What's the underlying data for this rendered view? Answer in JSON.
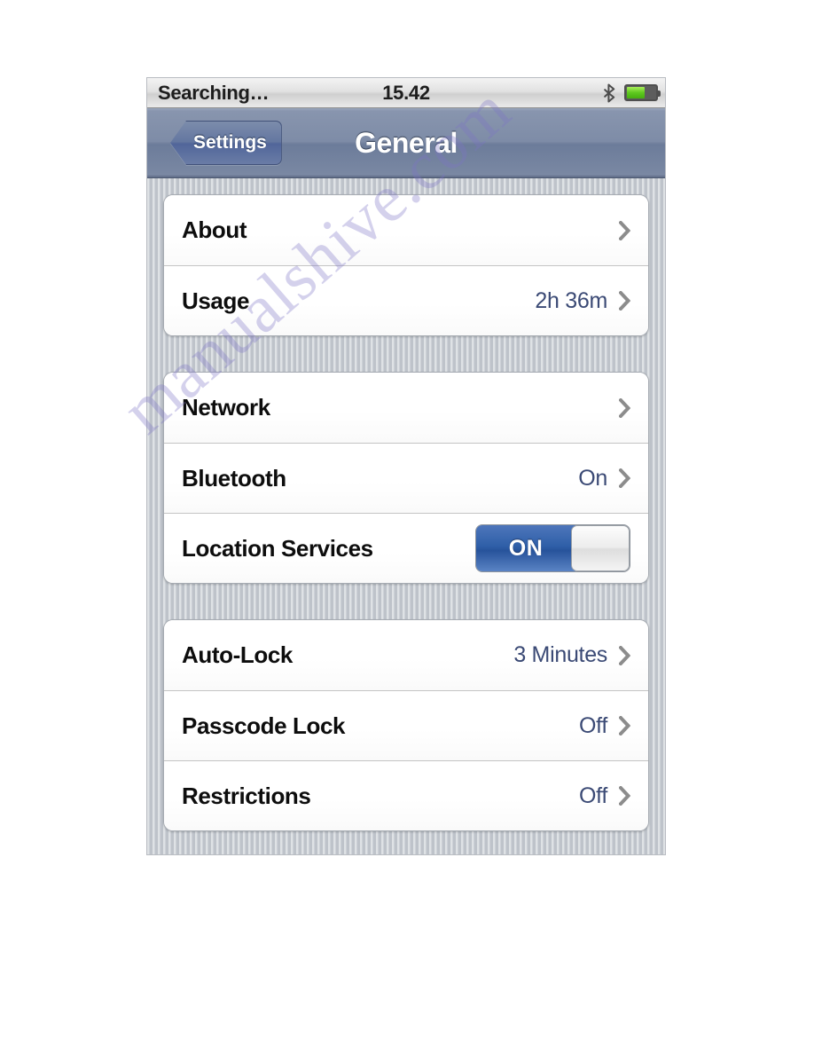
{
  "statusbar": {
    "carrier": "Searching…",
    "time": "15.42",
    "bluetooth_icon": "bluetooth-icon",
    "battery_icon": "battery-icon",
    "battery_level_percent": 58
  },
  "navbar": {
    "back_label": "Settings",
    "title": "General"
  },
  "groups": [
    {
      "rows": [
        {
          "label": "About",
          "value": "",
          "accessory": "chevron"
        },
        {
          "label": "Usage",
          "value": "2h 36m",
          "accessory": "chevron"
        }
      ]
    },
    {
      "rows": [
        {
          "label": "Network",
          "value": "",
          "accessory": "chevron"
        },
        {
          "label": "Bluetooth",
          "value": "On",
          "accessory": "chevron"
        },
        {
          "label": "Location Services",
          "value": "",
          "accessory": "switch",
          "switch_state": "ON"
        }
      ]
    },
    {
      "rows": [
        {
          "label": "Auto-Lock",
          "value": "3 Minutes",
          "accessory": "chevron"
        },
        {
          "label": "Passcode Lock",
          "value": "Off",
          "accessory": "chevron"
        },
        {
          "label": "Restrictions",
          "value": "Off",
          "accessory": "chevron"
        }
      ]
    }
  ],
  "watermark": {
    "text": "manualshive.com"
  },
  "colors": {
    "navbar_blue": "#6c7c9a",
    "value_text": "#3b4a75",
    "switch_on_blue": "#2f5fa8",
    "battery_green": "#5ec81e",
    "watermark": "#7c74c4"
  }
}
